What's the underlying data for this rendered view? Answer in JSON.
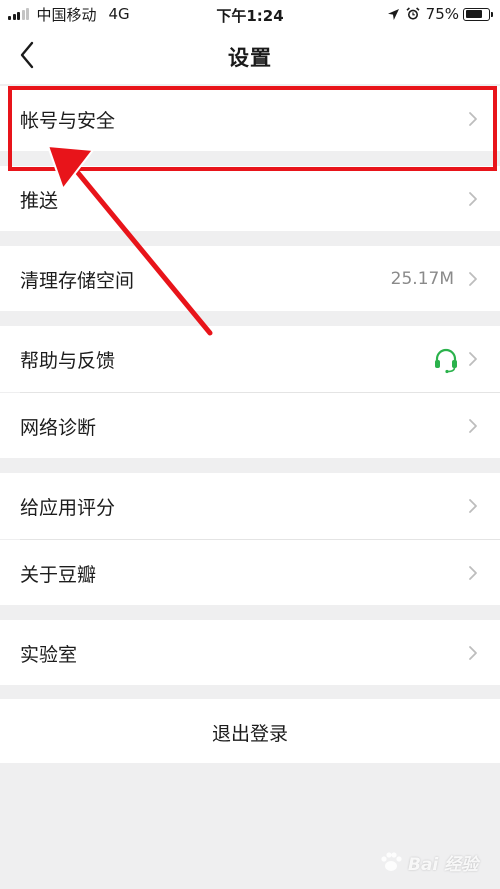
{
  "status_bar": {
    "carrier": "中国移动",
    "network": "4G",
    "time": "下午1:24",
    "battery": "75%",
    "battery_level": 0.75
  },
  "nav": {
    "title": "设置"
  },
  "settings": {
    "account_security": "帐号与安全",
    "push": "推送",
    "clear_storage": "清理存储空间",
    "storage_size": "25.17M",
    "help_feedback": "帮助与反馈",
    "network_diagnosis": "网络诊断",
    "rate_app": "给应用评分",
    "about": "关于豆瓣",
    "lab": "实验室",
    "logout": "退出登录"
  },
  "watermark": {
    "text": "Bai 经验"
  },
  "colors": {
    "highlight": "#e8141a",
    "headset": "#2bb24c",
    "background": "#efeff0"
  },
  "icons": [
    "signal-icon",
    "location-arrow-icon",
    "alarm-icon",
    "battery-icon",
    "back-chevron-icon",
    "chevron-right-icon",
    "headset-icon",
    "paw-icon"
  ]
}
